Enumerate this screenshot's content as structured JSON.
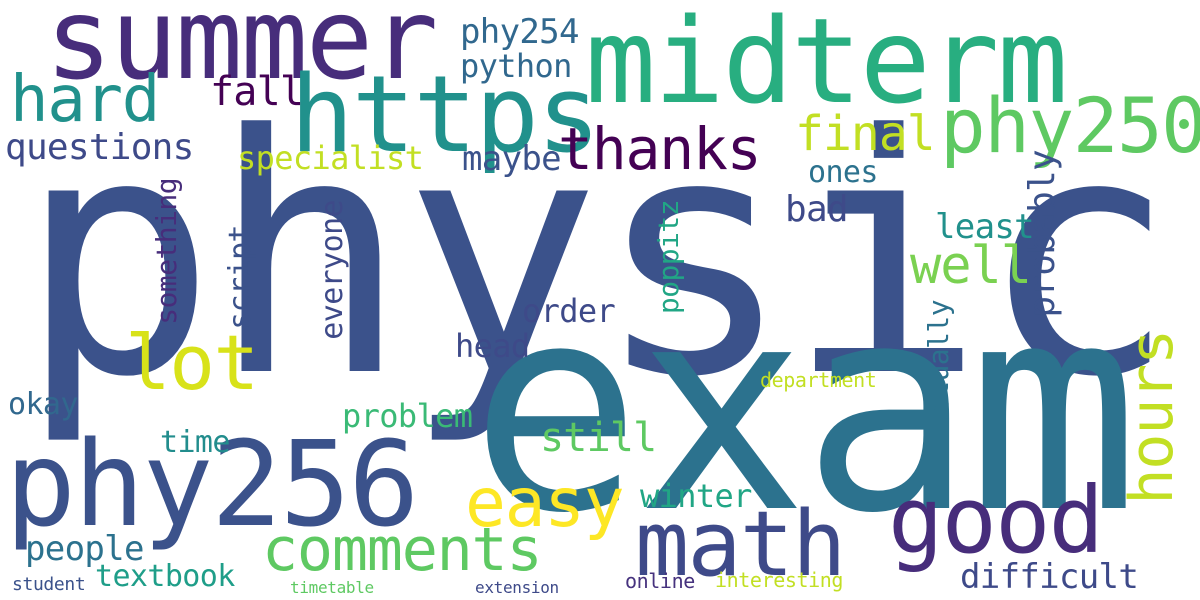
{
  "words": [
    {
      "text": "physics",
      "color": "#3b528b"
    },
    {
      "text": "exam",
      "color": "#2c728e"
    },
    {
      "text": "summer",
      "color": "#472d7b"
    },
    {
      "text": "midterm",
      "color": "#28ae80"
    },
    {
      "text": "https",
      "color": "#21918c"
    },
    {
      "text": "phy256",
      "color": "#3b528b"
    },
    {
      "text": "good",
      "color": "#472d7b"
    },
    {
      "text": "math",
      "color": "#3e4a89"
    },
    {
      "text": "comments",
      "color": "#5ec962"
    },
    {
      "text": "hard",
      "color": "#21918c"
    },
    {
      "text": "lot",
      "color": "#d8e219"
    },
    {
      "text": "phy250",
      "color": "#5ec962"
    },
    {
      "text": "thanks",
      "color": "#440154"
    },
    {
      "text": "easy",
      "color": "#fde725"
    },
    {
      "text": "final",
      "color": "#c2df23"
    },
    {
      "text": "hours",
      "color": "#c2df23"
    },
    {
      "text": "well",
      "color": "#7ad151"
    },
    {
      "text": "difficult",
      "color": "#3e4a89"
    },
    {
      "text": "questions",
      "color": "#3e4a89"
    },
    {
      "text": "specialist",
      "color": "#c2df23"
    },
    {
      "text": "python",
      "color": "#31688e"
    },
    {
      "text": "phy254",
      "color": "#31688e"
    },
    {
      "text": "fall",
      "color": "#440154"
    },
    {
      "text": "maybe",
      "color": "#3b528b"
    },
    {
      "text": "still",
      "color": "#5ec962"
    },
    {
      "text": "people",
      "color": "#2c728e"
    },
    {
      "text": "textbook",
      "color": "#1f9e89"
    },
    {
      "text": "winter",
      "color": "#21a685"
    },
    {
      "text": "bad",
      "color": "#3e4a89"
    },
    {
      "text": "least",
      "color": "#21918c"
    },
    {
      "text": "probably",
      "color": "#3b528b"
    },
    {
      "text": "order",
      "color": "#3e4a89"
    },
    {
      "text": "head",
      "color": "#3e4a89"
    },
    {
      "text": "problem",
      "color": "#3aba76"
    },
    {
      "text": "time",
      "color": "#228d8d"
    },
    {
      "text": "okay",
      "color": "#31688e"
    },
    {
      "text": "script",
      "color": "#3b528b"
    },
    {
      "text": "something",
      "color": "#472d7b"
    },
    {
      "text": "everyone",
      "color": "#3e4a89"
    },
    {
      "text": "actually",
      "color": "#2c728e"
    },
    {
      "text": "poppitz",
      "color": "#21a685"
    },
    {
      "text": "ones",
      "color": "#2c728e"
    },
    {
      "text": "department",
      "color": "#c2df23"
    },
    {
      "text": "interesting",
      "color": "#c2df23"
    },
    {
      "text": "online",
      "color": "#46327e"
    },
    {
      "text": "extension",
      "color": "#3e4a89"
    },
    {
      "text": "student",
      "color": "#3b528b"
    },
    {
      "text": "timetable",
      "color": "#5ec962"
    }
  ]
}
